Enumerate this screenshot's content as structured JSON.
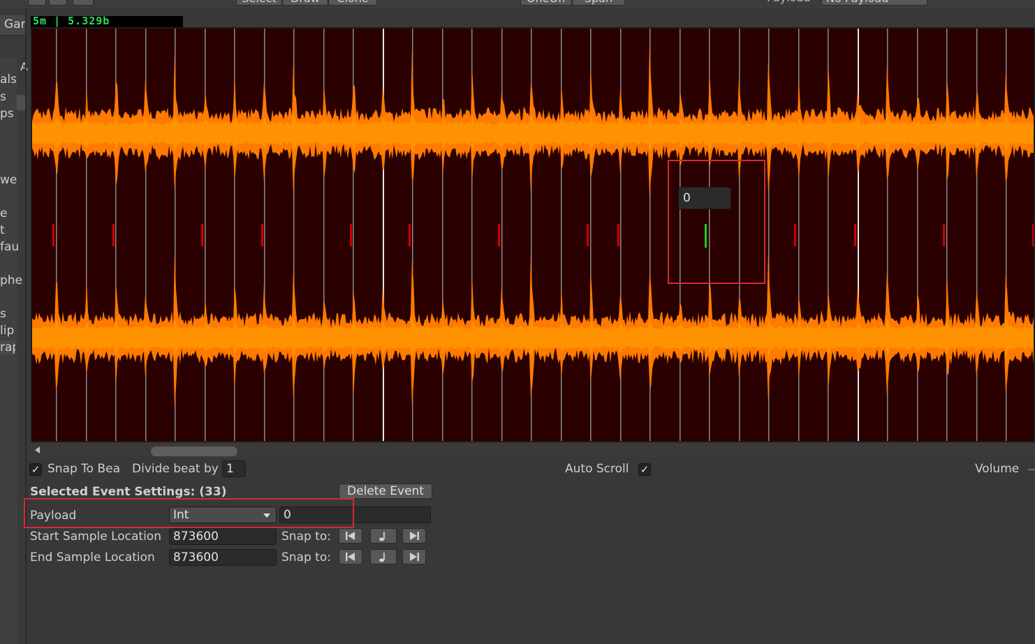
{
  "toolbar": {
    "mode_select": "Select",
    "mode_draw": "Draw",
    "mode_clone": "Clone",
    "oneoff": "OneOff",
    "span": "Span",
    "payload_label": "Payload",
    "payload_value": "No Payload"
  },
  "left_panel": {
    "tab_label": "Gar",
    "small_header": "A",
    "items": [
      "als",
      "s",
      "ps",
      "we",
      "e",
      "t",
      "fau",
      "phe",
      "s",
      "lip",
      "rap"
    ]
  },
  "timeline": {
    "readout": "5m | 5.329b",
    "event_payload": "0"
  },
  "options": {
    "snap_to_beat_label": "Snap To Bea",
    "snap_to_beat_checked": true,
    "divide_beat_label": "Divide beat by",
    "divide_beat_value": "1",
    "auto_scroll_label": "Auto Scroll",
    "auto_scroll_checked": true,
    "volume_label": "Volume"
  },
  "event_settings": {
    "title": "Selected Event Settings: (33)",
    "delete_label": "Delete Event",
    "payload_label": "Payload",
    "payload_type": "Int",
    "payload_value": "0",
    "start_label": "Start Sample Location",
    "start_value": "873600",
    "end_label": "End Sample Location",
    "end_value": "873600",
    "snap_label": "Snap to:"
  },
  "colors": {
    "waveform_bg": "#2a0000",
    "waveform_fill": "#ff8c00",
    "event_marker": "#cc0000",
    "selected_marker": "#22cc22",
    "highlight": "#d42b36"
  }
}
